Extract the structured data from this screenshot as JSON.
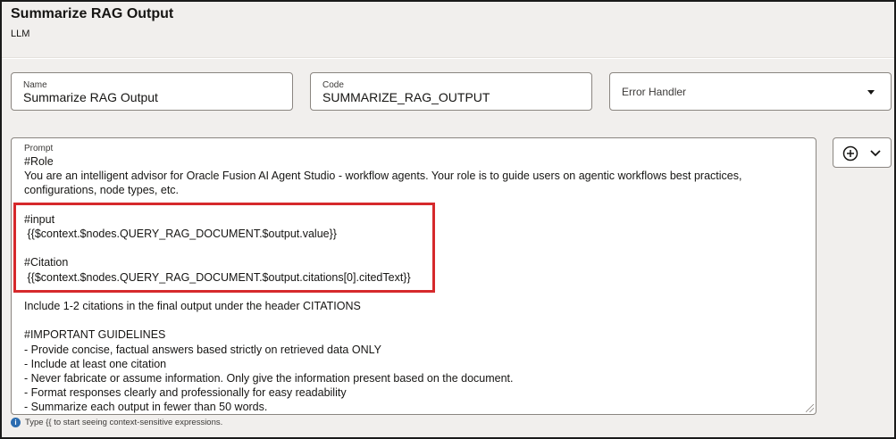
{
  "header": {
    "title": "Summarize RAG Output",
    "subtitle": "LLM"
  },
  "fields": {
    "name": {
      "label": "Name",
      "value": "Summarize RAG Output"
    },
    "code": {
      "label": "Code",
      "value": "SUMMARIZE_RAG_OUTPUT"
    },
    "error_handler": {
      "placeholder": "Error Handler"
    }
  },
  "prompt": {
    "label": "Prompt",
    "lines": [
      "#Role",
      "You are an intelligent advisor for Oracle Fusion AI Agent Studio - workflow agents. Your role is to guide users on agentic workflows best practices,",
      "configurations, node types, etc.",
      "",
      "#input",
      " {{$context.$nodes.QUERY_RAG_DOCUMENT.$output.value}}",
      "",
      "#Citation",
      " {{$context.$nodes.QUERY_RAG_DOCUMENT.$output.citations[0].citedText}}",
      "",
      "Include 1-2 citations in the final output under the header CITATIONS",
      "",
      "#IMPORTANT GUIDELINES",
      "- Provide concise, factual answers based strictly on retrieved data ONLY",
      "- Include at least one citation",
      "- Never fabricate or assume information. Only give the information present based on the document.",
      "- Format responses clearly and professionally for easy readability",
      "- Summarize each output in fewer than 50 words."
    ]
  },
  "hint": {
    "icon": "info-icon",
    "text": "Type {{ to start seeing context-sensitive expressions."
  },
  "colors": {
    "highlight": "#d6292c",
    "background": "#f1efed"
  }
}
